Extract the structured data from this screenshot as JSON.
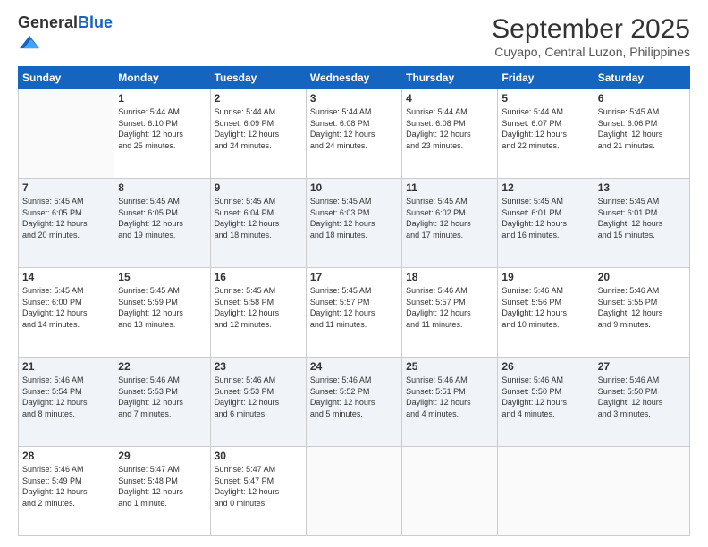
{
  "logo": {
    "general": "General",
    "blue": "Blue"
  },
  "header": {
    "month": "September 2025",
    "location": "Cuyapo, Central Luzon, Philippines"
  },
  "days_of_week": [
    "Sunday",
    "Monday",
    "Tuesday",
    "Wednesday",
    "Thursday",
    "Friday",
    "Saturday"
  ],
  "weeks": [
    [
      {
        "day": "",
        "info": ""
      },
      {
        "day": "1",
        "info": "Sunrise: 5:44 AM\nSunset: 6:10 PM\nDaylight: 12 hours\nand 25 minutes."
      },
      {
        "day": "2",
        "info": "Sunrise: 5:44 AM\nSunset: 6:09 PM\nDaylight: 12 hours\nand 24 minutes."
      },
      {
        "day": "3",
        "info": "Sunrise: 5:44 AM\nSunset: 6:08 PM\nDaylight: 12 hours\nand 24 minutes."
      },
      {
        "day": "4",
        "info": "Sunrise: 5:44 AM\nSunset: 6:08 PM\nDaylight: 12 hours\nand 23 minutes."
      },
      {
        "day": "5",
        "info": "Sunrise: 5:44 AM\nSunset: 6:07 PM\nDaylight: 12 hours\nand 22 minutes."
      },
      {
        "day": "6",
        "info": "Sunrise: 5:45 AM\nSunset: 6:06 PM\nDaylight: 12 hours\nand 21 minutes."
      }
    ],
    [
      {
        "day": "7",
        "info": "Sunrise: 5:45 AM\nSunset: 6:05 PM\nDaylight: 12 hours\nand 20 minutes."
      },
      {
        "day": "8",
        "info": "Sunrise: 5:45 AM\nSunset: 6:05 PM\nDaylight: 12 hours\nand 19 minutes."
      },
      {
        "day": "9",
        "info": "Sunrise: 5:45 AM\nSunset: 6:04 PM\nDaylight: 12 hours\nand 18 minutes."
      },
      {
        "day": "10",
        "info": "Sunrise: 5:45 AM\nSunset: 6:03 PM\nDaylight: 12 hours\nand 18 minutes."
      },
      {
        "day": "11",
        "info": "Sunrise: 5:45 AM\nSunset: 6:02 PM\nDaylight: 12 hours\nand 17 minutes."
      },
      {
        "day": "12",
        "info": "Sunrise: 5:45 AM\nSunset: 6:01 PM\nDaylight: 12 hours\nand 16 minutes."
      },
      {
        "day": "13",
        "info": "Sunrise: 5:45 AM\nSunset: 6:01 PM\nDaylight: 12 hours\nand 15 minutes."
      }
    ],
    [
      {
        "day": "14",
        "info": "Sunrise: 5:45 AM\nSunset: 6:00 PM\nDaylight: 12 hours\nand 14 minutes."
      },
      {
        "day": "15",
        "info": "Sunrise: 5:45 AM\nSunset: 5:59 PM\nDaylight: 12 hours\nand 13 minutes."
      },
      {
        "day": "16",
        "info": "Sunrise: 5:45 AM\nSunset: 5:58 PM\nDaylight: 12 hours\nand 12 minutes."
      },
      {
        "day": "17",
        "info": "Sunrise: 5:45 AM\nSunset: 5:57 PM\nDaylight: 12 hours\nand 11 minutes."
      },
      {
        "day": "18",
        "info": "Sunrise: 5:46 AM\nSunset: 5:57 PM\nDaylight: 12 hours\nand 11 minutes."
      },
      {
        "day": "19",
        "info": "Sunrise: 5:46 AM\nSunset: 5:56 PM\nDaylight: 12 hours\nand 10 minutes."
      },
      {
        "day": "20",
        "info": "Sunrise: 5:46 AM\nSunset: 5:55 PM\nDaylight: 12 hours\nand 9 minutes."
      }
    ],
    [
      {
        "day": "21",
        "info": "Sunrise: 5:46 AM\nSunset: 5:54 PM\nDaylight: 12 hours\nand 8 minutes."
      },
      {
        "day": "22",
        "info": "Sunrise: 5:46 AM\nSunset: 5:53 PM\nDaylight: 12 hours\nand 7 minutes."
      },
      {
        "day": "23",
        "info": "Sunrise: 5:46 AM\nSunset: 5:53 PM\nDaylight: 12 hours\nand 6 minutes."
      },
      {
        "day": "24",
        "info": "Sunrise: 5:46 AM\nSunset: 5:52 PM\nDaylight: 12 hours\nand 5 minutes."
      },
      {
        "day": "25",
        "info": "Sunrise: 5:46 AM\nSunset: 5:51 PM\nDaylight: 12 hours\nand 4 minutes."
      },
      {
        "day": "26",
        "info": "Sunrise: 5:46 AM\nSunset: 5:50 PM\nDaylight: 12 hours\nand 4 minutes."
      },
      {
        "day": "27",
        "info": "Sunrise: 5:46 AM\nSunset: 5:50 PM\nDaylight: 12 hours\nand 3 minutes."
      }
    ],
    [
      {
        "day": "28",
        "info": "Sunrise: 5:46 AM\nSunset: 5:49 PM\nDaylight: 12 hours\nand 2 minutes."
      },
      {
        "day": "29",
        "info": "Sunrise: 5:47 AM\nSunset: 5:48 PM\nDaylight: 12 hours\nand 1 minute."
      },
      {
        "day": "30",
        "info": "Sunrise: 5:47 AM\nSunset: 5:47 PM\nDaylight: 12 hours\nand 0 minutes."
      },
      {
        "day": "",
        "info": ""
      },
      {
        "day": "",
        "info": ""
      },
      {
        "day": "",
        "info": ""
      },
      {
        "day": "",
        "info": ""
      }
    ]
  ]
}
